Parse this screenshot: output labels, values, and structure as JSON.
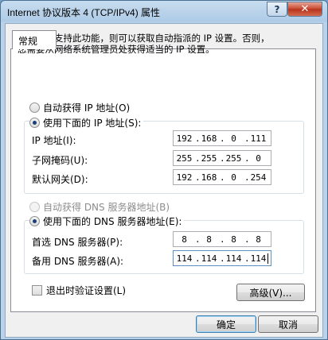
{
  "window": {
    "title": "Internet 协议版本 4 (TCP/IPv4) 属性",
    "help_label": "?",
    "close_label": "✕"
  },
  "tab": {
    "label": "常规"
  },
  "intro": {
    "line1": "如果网络支持此功能，则可以获取自动指派的 IP 设置。否则，",
    "line2": "您需要从网络系统管理员处获得适当的 IP 设置。"
  },
  "ip_mode": {
    "auto_label": "自动获得 IP 地址(O)",
    "manual_label": "使用下面的 IP 地址(S):",
    "selected": "manual"
  },
  "ip_fields": [
    {
      "label": "IP 地址(I):",
      "octets": [
        "192",
        "168",
        "0",
        "111"
      ]
    },
    {
      "label": "子网掩码(U):",
      "octets": [
        "255",
        "255",
        "255",
        "0"
      ]
    },
    {
      "label": "默认网关(D):",
      "octets": [
        "192",
        "168",
        "0",
        "254"
      ]
    }
  ],
  "dns_mode": {
    "auto_label": "自动获得 DNS 服务器地址(B)",
    "manual_label": "使用下面的 DNS 服务器地址(E):",
    "selected": "manual"
  },
  "dns_fields": [
    {
      "label": "首选 DNS 服务器(P):",
      "octets": [
        "8",
        "8",
        "8",
        "8"
      ]
    },
    {
      "label": "备用 DNS 服务器(A):",
      "octets": [
        "114",
        "114",
        "114",
        "114"
      ]
    }
  ],
  "validate_checkbox": {
    "label": "退出时验证设置(L)",
    "checked": false
  },
  "buttons": {
    "advanced": "高级(V)...",
    "ok": "确定",
    "cancel": "取消"
  }
}
